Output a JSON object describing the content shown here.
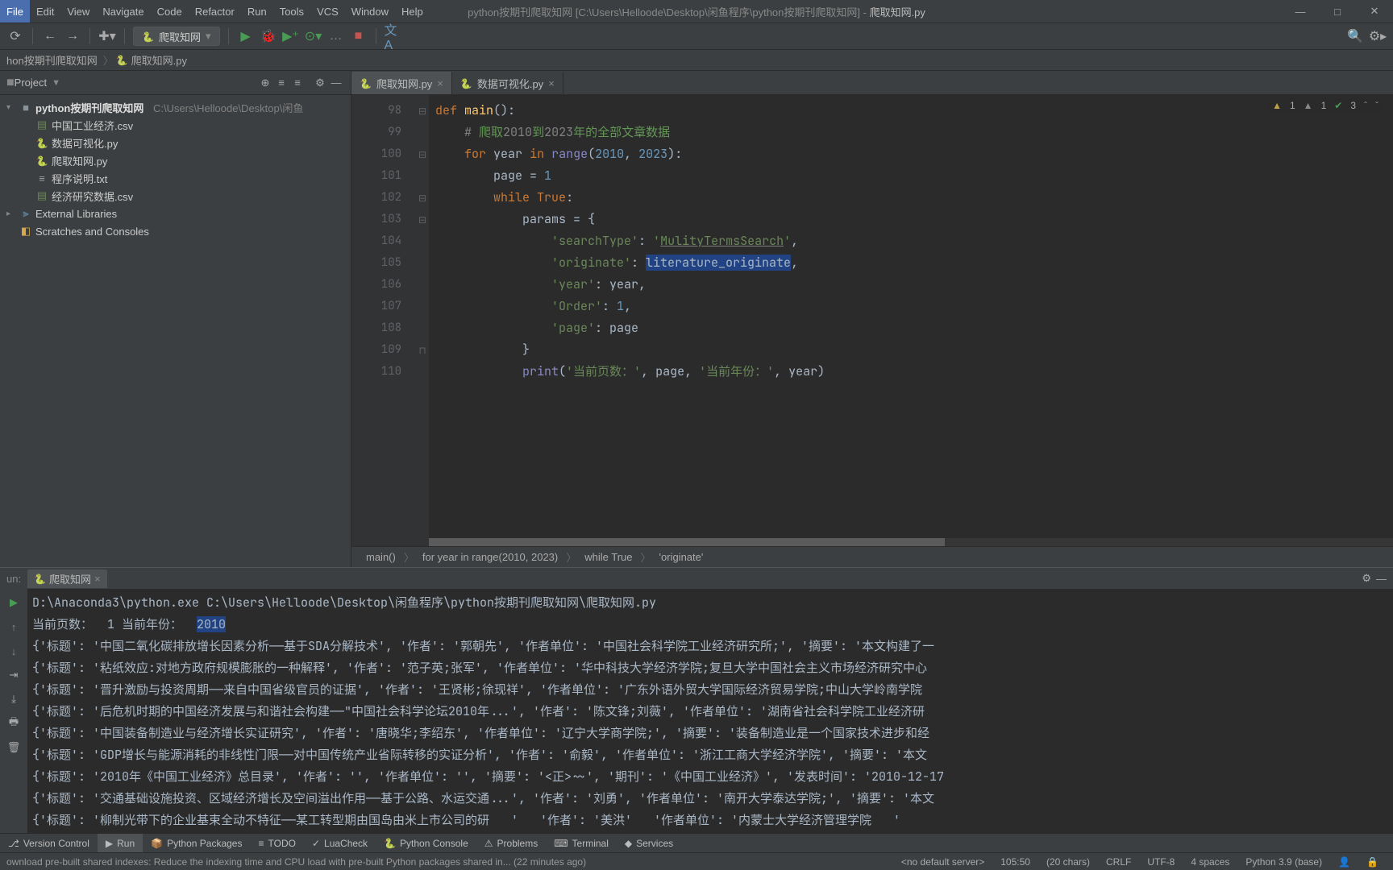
{
  "menu": {
    "items": [
      "File",
      "Edit",
      "View",
      "Navigate",
      "Code",
      "Refactor",
      "Run",
      "Tools",
      "VCS",
      "Window",
      "Help"
    ]
  },
  "title": {
    "dim": "python按期刊爬取知网 [C:\\Users\\Helloode\\Desktop\\闲鱼程序\\python按期刊爬取知网] - ",
    "bright": "爬取知网.py"
  },
  "toolbar": {
    "run_config": "爬取知网"
  },
  "nav": {
    "crumbs": [
      "hon按期刊爬取知网",
      "爬取知网.py"
    ],
    "icon": "py"
  },
  "project": {
    "header": "Project",
    "root": {
      "name": "python按期刊爬取知网",
      "path": "C:\\Users\\Helloode\\Desktop\\闲鱼"
    },
    "files": [
      {
        "name": "中国工业经济.csv",
        "kind": "csv"
      },
      {
        "name": "数据可视化.py",
        "kind": "py"
      },
      {
        "name": "爬取知网.py",
        "kind": "py"
      },
      {
        "name": "程序说明.txt",
        "kind": "txt"
      },
      {
        "name": "经济研究数据.csv",
        "kind": "csv"
      }
    ],
    "extlib": "External Libraries",
    "scratch": "Scratches and Consoles"
  },
  "editor_tabs": [
    {
      "name": "爬取知网.py",
      "active": true
    },
    {
      "name": "数据可视化.py",
      "active": false
    }
  ],
  "inspection": {
    "warn": "1",
    "weak": "1",
    "ok": "3"
  },
  "code": {
    "lines": [
      {
        "n": 98,
        "html": "<span class='kw'>def</span> <span class='fn'>main</span><span class='id'>():</span>"
      },
      {
        "n": 99,
        "html": "    <span class='cmt'># </span><span class='cmtcn'>爬取</span><span class='cmt'>2010</span><span class='cmtcn'>到</span><span class='cmt'>2023</span><span class='cmtcn'>年的全部文章数据</span>"
      },
      {
        "n": 100,
        "html": "    <span class='kw'>for</span> <span class='id'>year</span> <span class='kw'>in</span> <span class='bi'>range</span><span class='id'>(</span><span class='num'>2010</span><span class='id'>, </span><span class='num'>2023</span><span class='id'>):</span>"
      },
      {
        "n": 101,
        "html": "        <span class='id'>page = </span><span class='num'>1</span>"
      },
      {
        "n": 102,
        "html": "        <span class='kw'>while</span> <span class='kw'>True</span><span class='id'>:</span>"
      },
      {
        "n": 103,
        "html": "            <span class='id'>params = {</span>"
      },
      {
        "n": 104,
        "html": "                <span class='str'>'searchType'</span><span class='id'>: </span><span class='str'>'<u style=\"text-decoration-color:#808080\">MulityTermsSearch</u>'</span><span class='id'>,</span>"
      },
      {
        "n": 105,
        "html": "                <span class='str'>'originate'</span><span class='id'>: </span><span class='selword'>literature_originate</span><span class='id'>,</span>"
      },
      {
        "n": 106,
        "html": "                <span class='str'>'year'</span><span class='id'>: year,</span>"
      },
      {
        "n": 107,
        "html": "                <span class='str'>'Order'</span><span class='id'>: </span><span class='num'>1</span><span class='id'>,</span>"
      },
      {
        "n": 108,
        "html": "                <span class='str'>'page'</span><span class='id'>: page</span>"
      },
      {
        "n": 109,
        "html": "            <span class='id'>}</span>"
      },
      {
        "n": 110,
        "html": "            <span class='bi'>print</span><span class='id'>(</span><span class='str'>'当前页数：'</span><span class='id'>, page, </span><span class='str'>'当前年份：'</span><span class='id'>, year)</span>"
      }
    ]
  },
  "breadcrumb": [
    "main()",
    "for year in range(2010, 2023)",
    "while True",
    "'originate'"
  ],
  "run": {
    "label": "un:",
    "tab": "爬取知网",
    "lines": [
      "D:\\Anaconda3\\python.exe C:\\Users\\Helloode\\Desktop\\闲鱼程序\\python按期刊爬取知网\\爬取知网.py",
      "当前页数：  1 当前年份：  <span class='hl'>2010</span>",
      "{'标题': '中国二氧化碳排放增长因素分析——基于SDA分解技术', '作者': '郭朝先', '作者单位': '中国社会科学院工业经济研究所;', '摘要': '本文构建了一",
      "{'标题': '粘纸效应:对地方政府规模膨胀的一种解释', '作者': '范子英;张军', '作者单位': '华中科技大学经济学院;复旦大学中国社会主义市场经济研究中心",
      "{'标题': '晋升激励与投资周期——来自中国省级官员的证据', '作者': '王贤彬;徐现祥', '作者单位': '广东外语外贸大学国际经济贸易学院;中山大学岭南学院",
      "{'标题': '后危机时期的中国经济发展与和谐社会构建——\"中国社会科学论坛2010年...', '作者': '陈文锋;刘薇', '作者单位': '湖南省社会科学院工业经济研",
      "{'标题': '中国装备制造业与经济增长实证研究', '作者': '唐晓华;李绍东', '作者单位': '辽宁大学商学院;', '摘要': '装备制造业是一个国家技术进步和经",
      "{'标题': 'GDP增长与能源消耗的非线性门限——对中国传统产业省际转移的实证分析', '作者': '俞毅', '作者单位': '浙江工商大学经济学院', '摘要': '本文",
      "{'标题': '2010年《中国工业经济》总目录', '作者': '', '作者单位': '', '摘要': '<正>~~', '期刊': '《中国工业经济》', '发表时间': '2010-12-17",
      "{'标题': '交通基础设施投资、区域经济增长及空间溢出作用——基于公路、水运交通...', '作者': '刘勇', '作者单位': '南开大学泰达学院;', '摘要': '本文",
      "{'标题': '柳制光带下的企业基束全动不特征——某工转型期由国岛由米上市公司的研   '   '作者': '美洪'   '作者单位': '内蒙士大学经济管理学院   '"
    ]
  },
  "tools": [
    {
      "icon": "⎇",
      "label": "Version Control"
    },
    {
      "icon": "▶",
      "label": "Run",
      "active": true
    },
    {
      "icon": "📦",
      "label": "Python Packages"
    },
    {
      "icon": "≡",
      "label": "TODO"
    },
    {
      "icon": "✓",
      "label": "LuaCheck"
    },
    {
      "icon": "🐍",
      "label": "Python Console"
    },
    {
      "icon": "⚠",
      "label": "Problems"
    },
    {
      "icon": "⌨",
      "label": "Terminal"
    },
    {
      "icon": "◆",
      "label": "Services"
    }
  ],
  "status": {
    "msg": "ownload pre-built shared indexes: Reduce the indexing time and CPU load with pre-built Python packages shared in... (22 minutes ago)",
    "server": "<no default server>",
    "pos": "105:50",
    "sel": "(20 chars)",
    "le": "CRLF",
    "enc": "UTF-8",
    "indent": "4 spaces",
    "py": "Python 3.9 (base)"
  }
}
